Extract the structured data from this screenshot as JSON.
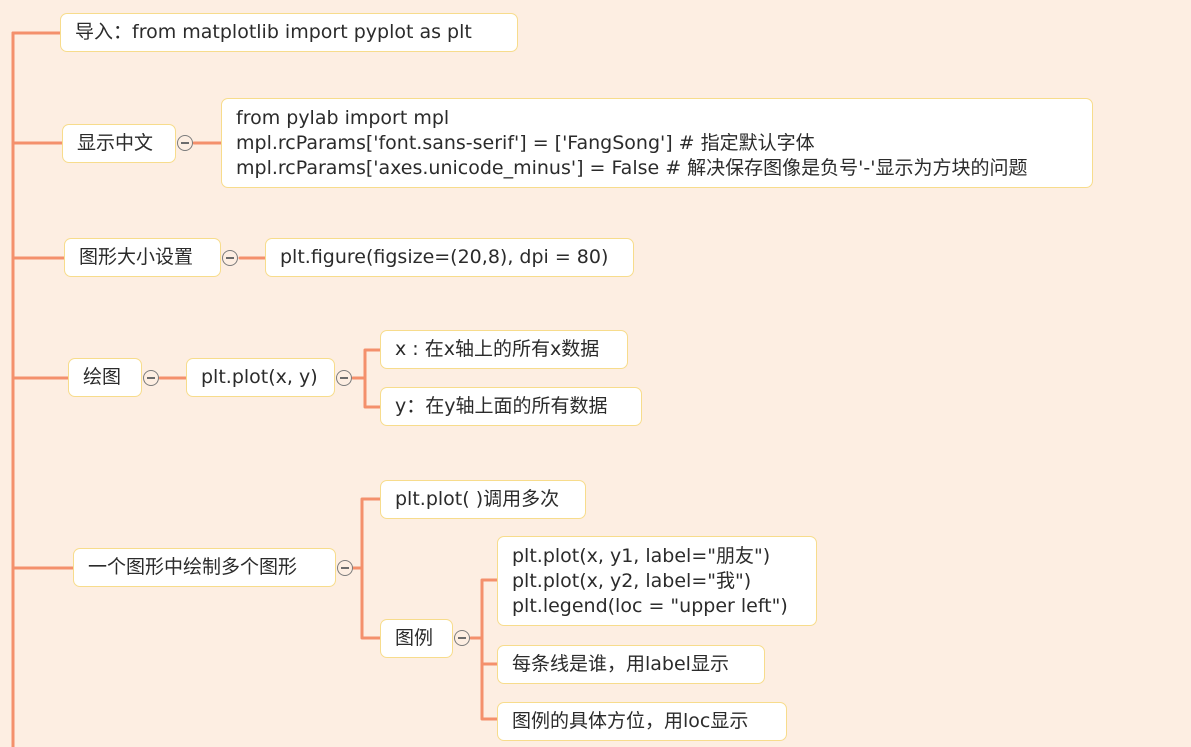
{
  "colors": {
    "background": "#fdeee2",
    "connector": "#f4906c",
    "node_border": "#f7dc8c",
    "node_fill": "#ffffff"
  },
  "mindmap": {
    "import": {
      "label": "导入：from matplotlib import pyplot as plt"
    },
    "chinese_display": {
      "label": "显示中文",
      "code_lines": [
        "from pylab import mpl",
        "mpl.rcParams['font.sans-serif'] = ['FangSong'] # 指定默认字体",
        "mpl.rcParams['axes.unicode_minus'] = False # 解决保存图像是负号'-'显示为方块的问题"
      ]
    },
    "figure_size": {
      "label": "图形大小设置",
      "code": "plt.figure(figsize=(20,8), dpi = 80)"
    },
    "plotting": {
      "label": "绘图",
      "call": "plt.plot(x, y)",
      "params": [
        "x : 在x轴上的所有x数据",
        "y：在y轴上面的所有数据"
      ]
    },
    "multi_plots": {
      "label": "一个图形中绘制多个图形",
      "repeat_call": "plt.plot( )调用多次",
      "legend": {
        "label": "图例",
        "code_lines": [
          "plt.plot(x, y1, label=\"朋友\")",
          "plt.plot(x, y2, label=\"我\")",
          "plt.legend(loc = \"upper left\")"
        ],
        "notes": [
          "每条线是谁，用label显示",
          "图例的具体方位，用loc显示"
        ]
      }
    }
  }
}
